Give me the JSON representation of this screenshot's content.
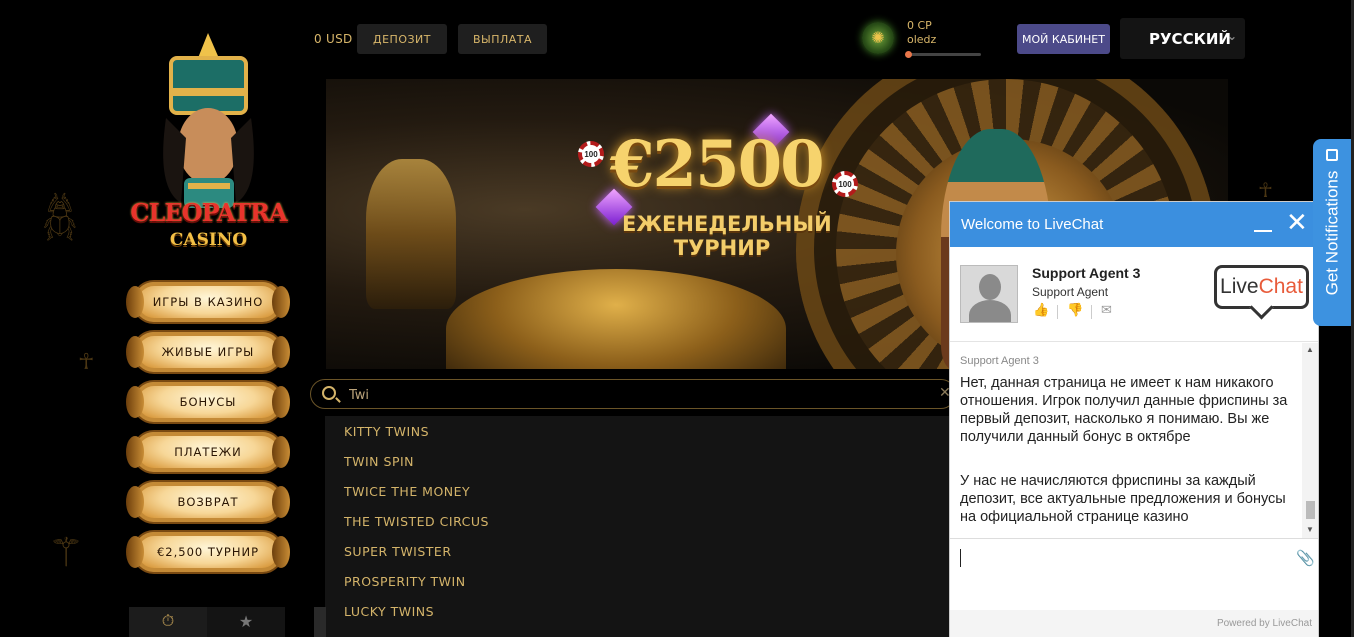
{
  "header": {
    "balance": "0 USD",
    "deposit_label": "ДЕПОЗИТ",
    "withdraw_label": "ВЫПЛАТА",
    "cp_points": "0 CP",
    "username": "oledz",
    "cabinet_label": "МОЙ КАБИНЕТ",
    "language": "РУССКИЙ"
  },
  "logo": {
    "line1": "CLEOPATRA",
    "line2": "CASINO"
  },
  "sidebar": {
    "items": [
      {
        "label": "ИГРЫ В КАЗИНО"
      },
      {
        "label": "ЖИВЫЕ ИГРЫ"
      },
      {
        "label": "БОНУСЫ"
      },
      {
        "label": "ПЛАТЕЖИ"
      },
      {
        "label": "ВОЗВРАТ"
      },
      {
        "label": "€2,500 ТУРНИР"
      }
    ]
  },
  "banner": {
    "amount": "€2500",
    "subtitle_line1": "ЕЖЕНЕДЕЛЬНЫЙ",
    "subtitle_line2": "ТУРНИР",
    "chip_value": "100"
  },
  "search": {
    "value": "Twi",
    "results": [
      "KITTY TWINS",
      "TWIN SPIN",
      "TWICE THE MONEY",
      "THE TWISTED CIRCUS",
      "SUPER TWISTER",
      "PROSPERITY TWIN",
      "LUCKY TWINS"
    ]
  },
  "livechat": {
    "title": "Welcome to LiveChat",
    "agent_name": "Support Agent 3",
    "agent_role": "Support Agent",
    "logo_part1": "Live",
    "logo_part2": "Chat",
    "message_author": "Support Agent 3",
    "message_1": "Нет, данная страница не имеет к нам никакого отношения. Игрок получил данные фриспины за первый депозит, насколько я понимаю. Вы же получили данный бонус в октябре",
    "message_2": "У нас не начисляются фриспины за каждый депозит, все актуальные предложения и бонусы на официальной странице казино",
    "powered_by": "Powered by LiveChat"
  },
  "notifications": {
    "label": "Get Notifications"
  },
  "colors": {
    "gold": "#d8b66a",
    "cabinet": "#4c4a89",
    "livechat_blue": "#3b8fdf"
  }
}
